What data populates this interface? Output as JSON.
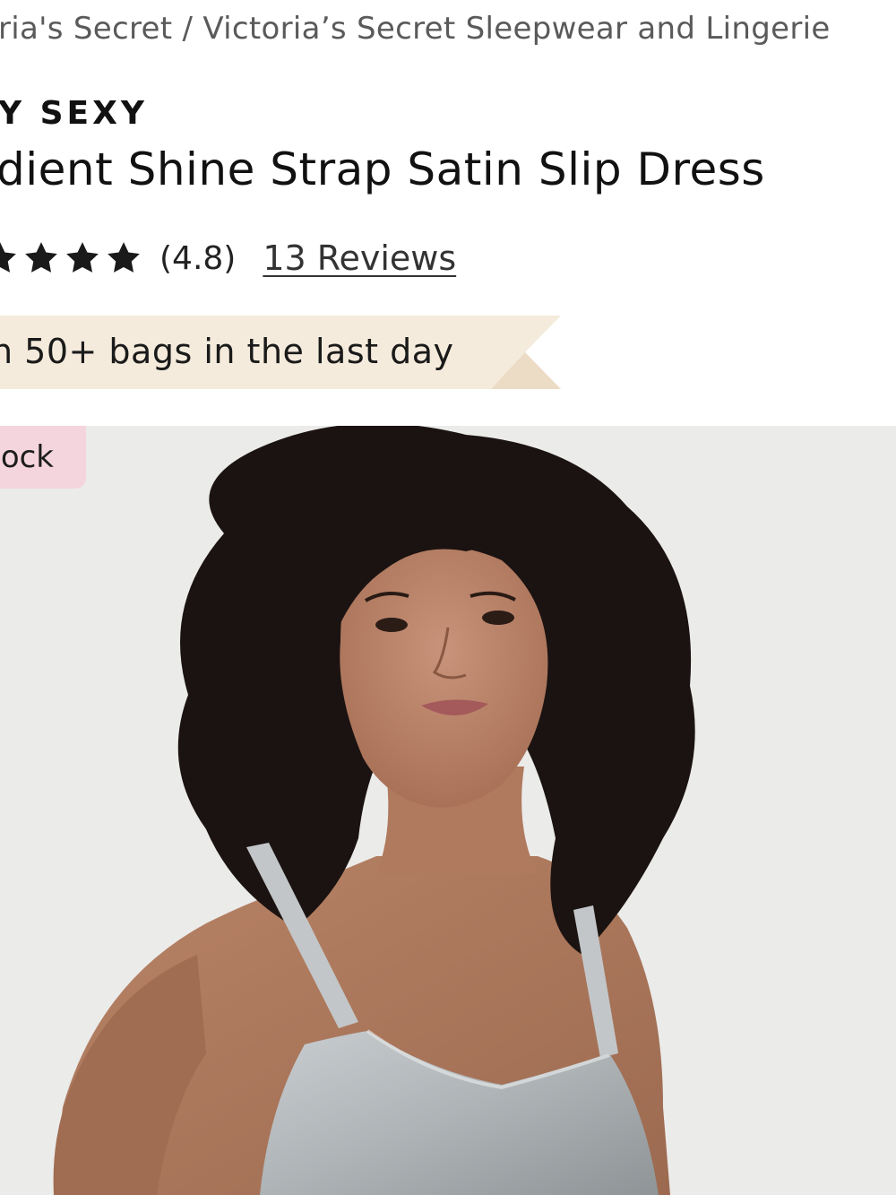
{
  "breadcrumb": {
    "text": "ria's Secret / Victoria’s Secret Sleepwear and Lingerie"
  },
  "product": {
    "brand": "Y SEXY",
    "title": "dient Shine Strap Satin Slip Dress"
  },
  "rating": {
    "stars_visible": 3,
    "value_text": "(4.8)",
    "reviews_label": "13 Reviews"
  },
  "promo": {
    "text": "n 50+ bags in the last day"
  },
  "image": {
    "badge_text": "ock"
  },
  "colors": {
    "banner": "#f5ebdc",
    "badge": "#f5d5dd",
    "hero_bg": "#ebebea",
    "star": "#1a1a1a"
  }
}
